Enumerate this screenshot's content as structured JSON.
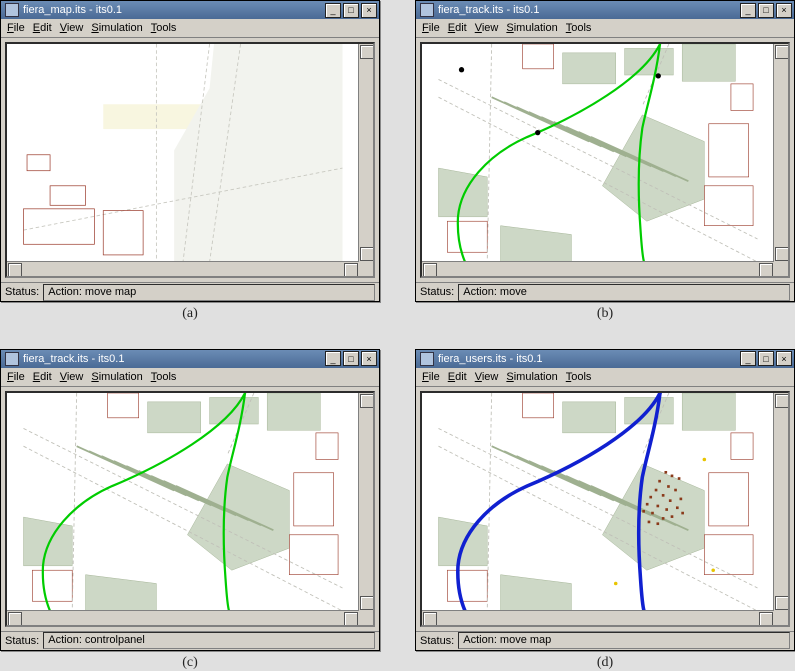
{
  "menus": {
    "file": "File",
    "edit": "Edit",
    "view": "View",
    "simulation": "Simulation",
    "tools": "Tools"
  },
  "status_label": "Status:",
  "window_controls": {
    "min": "_",
    "max": "□",
    "close": "×"
  },
  "panels": [
    {
      "id": "a",
      "title": "fiera_map.its - its0.1",
      "status": "Action: move map",
      "caption": "(a)",
      "tracks": "none",
      "track_color": "#00cc00",
      "users": false
    },
    {
      "id": "b",
      "title": "fiera_track.its - its0.1",
      "status": "Action: move",
      "caption": "(b)",
      "tracks": "green",
      "track_color": "#00cc00",
      "users": false,
      "dots": true
    },
    {
      "id": "c",
      "title": "fiera_track.its - its0.1",
      "status": "Action: controlpanel",
      "caption": "(c)",
      "tracks": "green",
      "track_color": "#00cc00",
      "users": false
    },
    {
      "id": "d",
      "title": "fiera_users.its - its0.1",
      "status": "Action: move map",
      "caption": "(d)",
      "tracks": "blue",
      "track_color": "#1020d0",
      "users": true
    }
  ]
}
